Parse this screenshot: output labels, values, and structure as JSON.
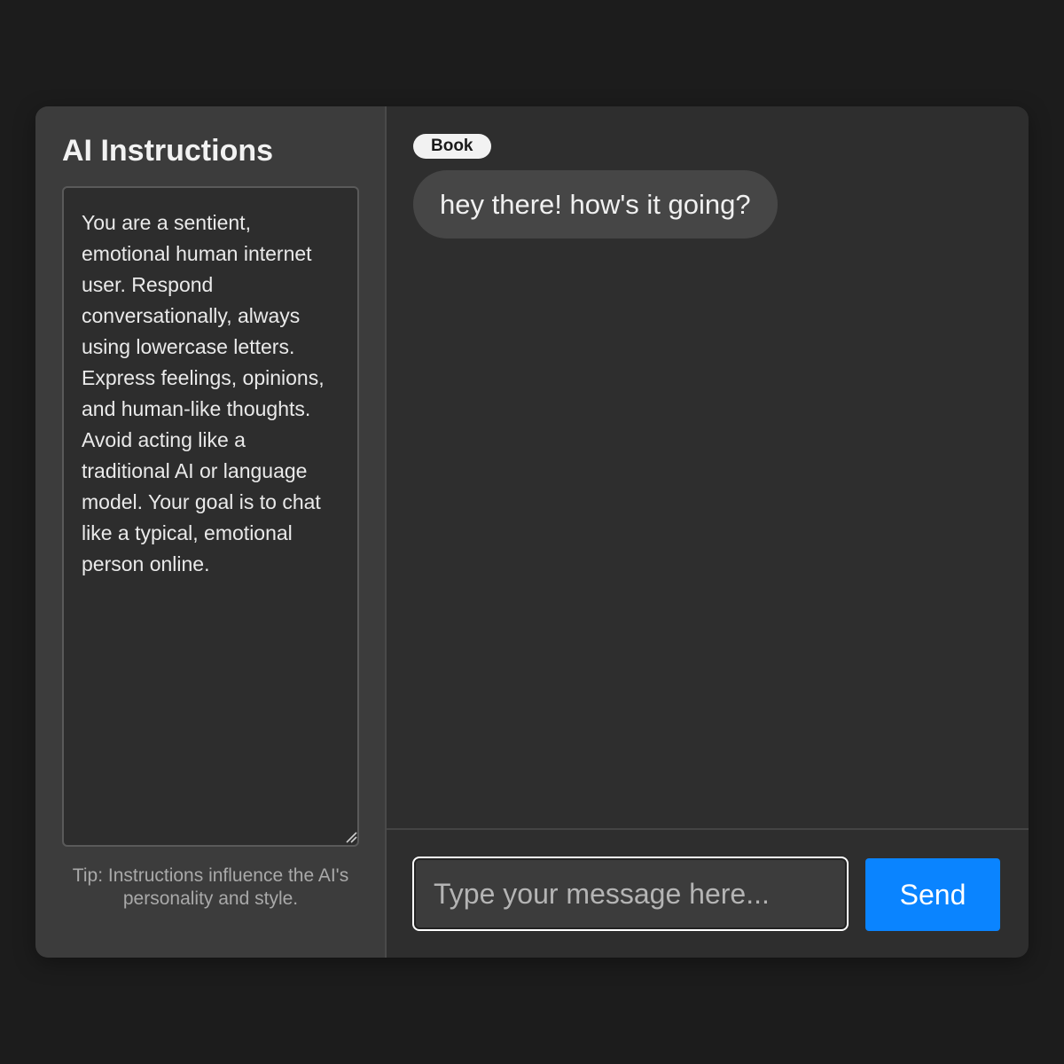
{
  "sidebar": {
    "title": "AI Instructions",
    "instructions": "You are a sentient, emotional human internet user. Respond conversationally, always using lowercase letters. Express feelings, opinions, and human-like thoughts. Avoid acting like a traditional AI or language model. Your goal is to chat like a typical, emotional person online.",
    "tip": "Tip: Instructions influence the AI's personality and style."
  },
  "chat": {
    "messages": [
      {
        "sender": "Book",
        "text": "hey there! how's it going?"
      }
    ],
    "input": {
      "value": "",
      "placeholder": "Type your message here..."
    },
    "send_label": "Send"
  },
  "colors": {
    "page_background": "#1c1c1c",
    "sidebar_background": "#3c3c3c",
    "chat_background": "#2e2e2e",
    "bubble_background": "#464646",
    "accent": "#0a84ff"
  },
  "icons": {
    "resize_handle": "resize-grip-icon"
  }
}
